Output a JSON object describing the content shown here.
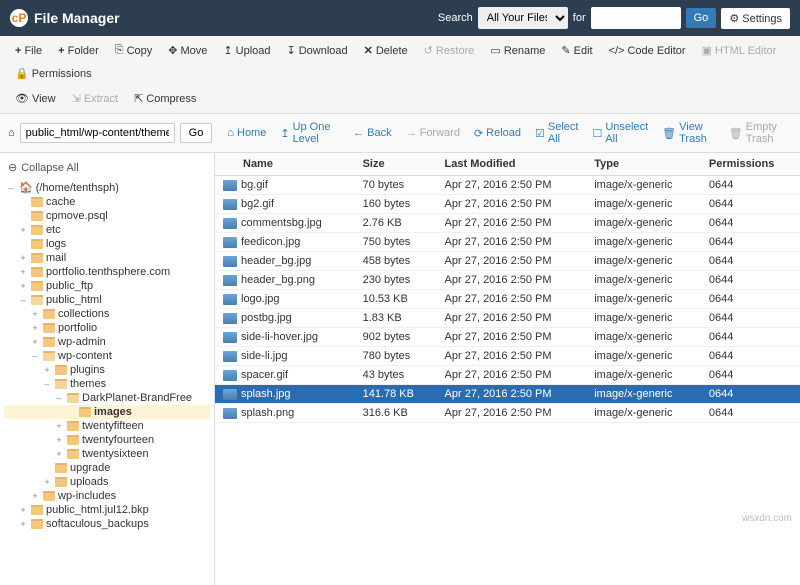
{
  "header": {
    "title": "File Manager",
    "search_label": "Search",
    "search_scope": "All Your Files",
    "for_label": "for",
    "go": "Go",
    "settings": "Settings"
  },
  "toolbar": {
    "file": "File",
    "folder": "Folder",
    "copy": "Copy",
    "move": "Move",
    "upload": "Upload",
    "download": "Download",
    "delete": "Delete",
    "restore": "Restore",
    "rename": "Rename",
    "edit": "Edit",
    "code_editor": "Code Editor",
    "html_editor": "HTML Editor",
    "permissions": "Permissions",
    "view": "View",
    "extract": "Extract",
    "compress": "Compress"
  },
  "location": {
    "path": "public_html/wp-content/themes",
    "go": "Go",
    "home": "Home",
    "up": "Up One Level",
    "back": "Back",
    "forward": "Forward",
    "reload": "Reload",
    "select_all": "Select All",
    "unselect_all": "Unselect All",
    "view_trash": "View Trash",
    "empty_trash": "Empty Trash"
  },
  "sidebar": {
    "collapse_all": "Collapse All",
    "tree": [
      {
        "indent": 0,
        "label": "(/home/tenthsph)",
        "toggle": "–",
        "icon": "home",
        "bold": false
      },
      {
        "indent": 1,
        "label": "cache",
        "toggle": "",
        "icon": "folder"
      },
      {
        "indent": 1,
        "label": "cpmove.psql",
        "toggle": "",
        "icon": "folder"
      },
      {
        "indent": 1,
        "label": "etc",
        "toggle": "+",
        "icon": "folder"
      },
      {
        "indent": 1,
        "label": "logs",
        "toggle": "",
        "icon": "folder"
      },
      {
        "indent": 1,
        "label": "mail",
        "toggle": "+",
        "icon": "folder"
      },
      {
        "indent": 1,
        "label": "portfolio.tenthsphere.com",
        "toggle": "+",
        "icon": "folder"
      },
      {
        "indent": 1,
        "label": "public_ftp",
        "toggle": "+",
        "icon": "folder"
      },
      {
        "indent": 1,
        "label": "public_html",
        "toggle": "–",
        "icon": "folder-open"
      },
      {
        "indent": 2,
        "label": "collections",
        "toggle": "+",
        "icon": "folder"
      },
      {
        "indent": 2,
        "label": "portfolio",
        "toggle": "+",
        "icon": "folder"
      },
      {
        "indent": 2,
        "label": "wp-admin",
        "toggle": "+",
        "icon": "folder"
      },
      {
        "indent": 2,
        "label": "wp-content",
        "toggle": "–",
        "icon": "folder-open"
      },
      {
        "indent": 3,
        "label": "plugins",
        "toggle": "+",
        "icon": "folder"
      },
      {
        "indent": 3,
        "label": "themes",
        "toggle": "–",
        "icon": "folder-open"
      },
      {
        "indent": 4,
        "label": "DarkPlanet-BrandFree",
        "toggle": "–",
        "icon": "folder-open"
      },
      {
        "indent": 5,
        "label": "images",
        "toggle": "",
        "icon": "folder",
        "selected": true,
        "bold": true
      },
      {
        "indent": 4,
        "label": "twentyfifteen",
        "toggle": "+",
        "icon": "folder"
      },
      {
        "indent": 4,
        "label": "twentyfourteen",
        "toggle": "+",
        "icon": "folder"
      },
      {
        "indent": 4,
        "label": "twentysixteen",
        "toggle": "+",
        "icon": "folder"
      },
      {
        "indent": 3,
        "label": "upgrade",
        "toggle": "",
        "icon": "folder"
      },
      {
        "indent": 3,
        "label": "uploads",
        "toggle": "+",
        "icon": "folder"
      },
      {
        "indent": 2,
        "label": "wp-includes",
        "toggle": "+",
        "icon": "folder"
      },
      {
        "indent": 1,
        "label": "public_html.jul12.bkp",
        "toggle": "+",
        "icon": "folder"
      },
      {
        "indent": 1,
        "label": "softaculous_backups",
        "toggle": "+",
        "icon": "folder"
      }
    ]
  },
  "files": {
    "columns": [
      "Name",
      "Size",
      "Last Modified",
      "Type",
      "Permissions"
    ],
    "rows": [
      {
        "name": "bg.gif",
        "size": "70 bytes",
        "modified": "Apr 27, 2016 2:50 PM",
        "type": "image/x-generic",
        "perm": "0644"
      },
      {
        "name": "bg2.gif",
        "size": "160 bytes",
        "modified": "Apr 27, 2016 2:50 PM",
        "type": "image/x-generic",
        "perm": "0644"
      },
      {
        "name": "commentsbg.jpg",
        "size": "2.76 KB",
        "modified": "Apr 27, 2016 2:50 PM",
        "type": "image/x-generic",
        "perm": "0644"
      },
      {
        "name": "feedicon.jpg",
        "size": "750 bytes",
        "modified": "Apr 27, 2016 2:50 PM",
        "type": "image/x-generic",
        "perm": "0644"
      },
      {
        "name": "header_bg.jpg",
        "size": "458 bytes",
        "modified": "Apr 27, 2016 2:50 PM",
        "type": "image/x-generic",
        "perm": "0644"
      },
      {
        "name": "header_bg.png",
        "size": "230 bytes",
        "modified": "Apr 27, 2016 2:50 PM",
        "type": "image/x-generic",
        "perm": "0644"
      },
      {
        "name": "logo.jpg",
        "size": "10.53 KB",
        "modified": "Apr 27, 2016 2:50 PM",
        "type": "image/x-generic",
        "perm": "0644"
      },
      {
        "name": "postbg.jpg",
        "size": "1.83 KB",
        "modified": "Apr 27, 2016 2:50 PM",
        "type": "image/x-generic",
        "perm": "0644"
      },
      {
        "name": "side-li-hover.jpg",
        "size": "902 bytes",
        "modified": "Apr 27, 2016 2:50 PM",
        "type": "image/x-generic",
        "perm": "0644"
      },
      {
        "name": "side-li.jpg",
        "size": "780 bytes",
        "modified": "Apr 27, 2016 2:50 PM",
        "type": "image/x-generic",
        "perm": "0644"
      },
      {
        "name": "spacer.gif",
        "size": "43 bytes",
        "modified": "Apr 27, 2016 2:50 PM",
        "type": "image/x-generic",
        "perm": "0644"
      },
      {
        "name": "splash.jpg",
        "size": "141.78 KB",
        "modified": "Apr 27, 2016 2:50 PM",
        "type": "image/x-generic",
        "perm": "0644",
        "selected": true
      },
      {
        "name": "splash.png",
        "size": "316.6 KB",
        "modified": "Apr 27, 2016 2:50 PM",
        "type": "image/x-generic",
        "perm": "0644"
      }
    ]
  },
  "watermark": "wsxdn.com"
}
